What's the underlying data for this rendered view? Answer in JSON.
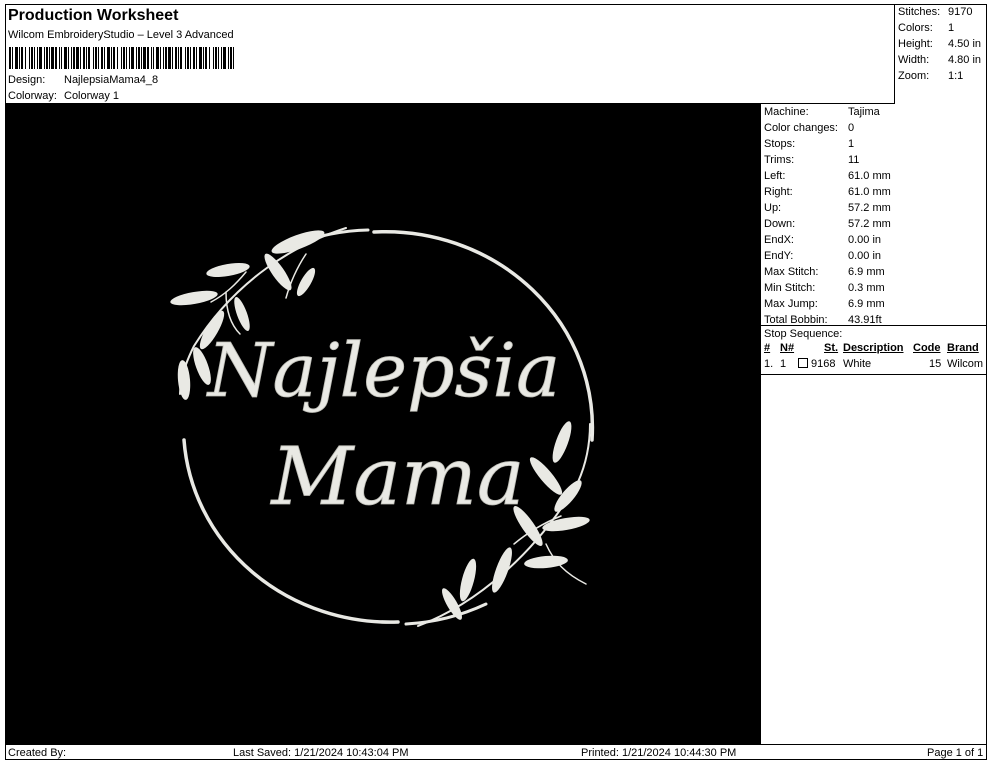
{
  "header": {
    "title": "Production Worksheet",
    "subtitle": "Wilcom EmbroideryStudio – Level 3 Advanced",
    "design_label": "Design:",
    "design_value": "NajlepsiaMama4_8",
    "colorway_label": "Colorway:",
    "colorway_value": "Colorway 1"
  },
  "summary": {
    "stitches_label": "Stitches:",
    "stitches": "9170",
    "colors_label": "Colors:",
    "colors": "1",
    "height_label": "Height:",
    "height": "4.50 in",
    "width_label": "Width:",
    "width": "4.80 in",
    "zoom_label": "Zoom:",
    "zoom": "1:1"
  },
  "design": {
    "line1": "Najlepšia",
    "line2": "Mama",
    "thread_color": "#e9e9e4",
    "background": "#000000"
  },
  "info": {
    "machine_label": "Machine:",
    "machine": "Tajima",
    "color_changes_label": "Color changes:",
    "color_changes": "0",
    "stops_label": "Stops:",
    "stops": "1",
    "trims_label": "Trims:",
    "trims": "11",
    "left_label": "Left:",
    "left": "61.0 mm",
    "right_label": "Right:",
    "right": "61.0 mm",
    "up_label": "Up:",
    "up": "57.2 mm",
    "down_label": "Down:",
    "down": "57.2 mm",
    "endx_label": "EndX:",
    "endx": "0.00 in",
    "endy_label": "EndY:",
    "endy": "0.00 in",
    "max_stitch_label": "Max Stitch:",
    "max_stitch": "6.9 mm",
    "min_stitch_label": "Min Stitch:",
    "min_stitch": "0.3 mm",
    "max_jump_label": "Max Jump:",
    "max_jump": "6.9 mm",
    "total_bobbin_label": "Total Bobbin:",
    "total_bobbin": "43.91ft"
  },
  "stop_sequence": {
    "title": "Stop Sequence:",
    "columns": [
      "#",
      "N#",
      "St.",
      "Description",
      "Code",
      "Brand"
    ],
    "rows": [
      {
        "index": "1.",
        "n": "1",
        "stitches": "9168",
        "description": "White",
        "code": "15",
        "brand": "Wilcom",
        "swatch": "#ffffff"
      }
    ]
  },
  "footer": {
    "created_by": "Created By:",
    "last_saved": "Last Saved: 1/21/2024 10:43:04 PM",
    "printed": "Printed: 1/21/2024 10:44:30 PM",
    "page": "Page 1 of 1"
  }
}
